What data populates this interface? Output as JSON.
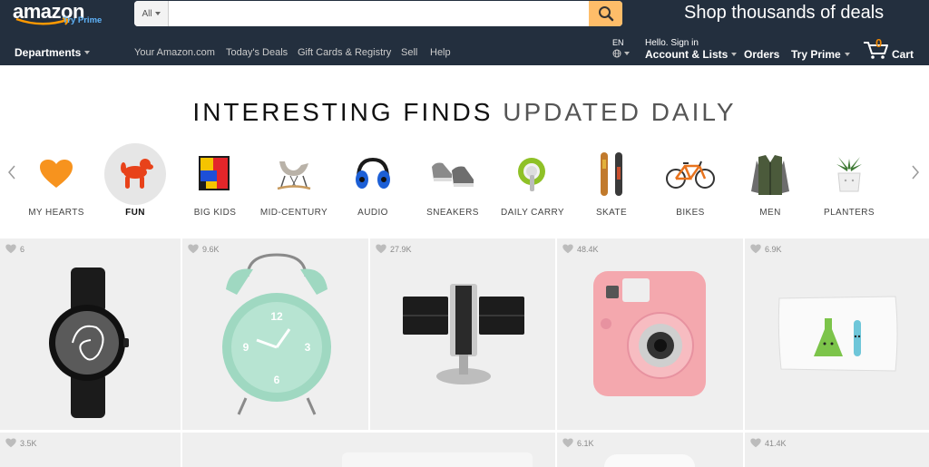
{
  "header": {
    "logo_text": "amazon",
    "logo_prime": "Try Prime",
    "search": {
      "category": "All",
      "placeholder": "",
      "value": ""
    },
    "promo": "Shop thousands of deals",
    "departments": "Departments",
    "nav_links": [
      "Your Amazon.com",
      "Today's Deals",
      "Gift Cards & Registry",
      "Sell",
      "Help"
    ],
    "language": "EN",
    "account_hello": "Hello. Sign in",
    "account_main": "Account & Lists",
    "orders": "Orders",
    "try_prime": "Try Prime",
    "cart_count": "0",
    "cart_label": "Cart"
  },
  "hero": {
    "bold": "INTERESTING FINDS",
    "light": "UPDATED DAILY"
  },
  "categories": [
    {
      "label": "MY HEARTS",
      "icon": "heart-icon",
      "active": false
    },
    {
      "label": "FUN",
      "icon": "balloon-dog-icon",
      "active": true
    },
    {
      "label": "BIG KIDS",
      "icon": "puzzle-blocks-icon",
      "active": false
    },
    {
      "label": "MID-CENTURY",
      "icon": "eames-chair-icon",
      "active": false
    },
    {
      "label": "AUDIO",
      "icon": "headphones-icon",
      "active": false
    },
    {
      "label": "SNEAKERS",
      "icon": "sneakers-icon",
      "active": false
    },
    {
      "label": "DAILY CARRY",
      "icon": "key-ring-icon",
      "active": false
    },
    {
      "label": "SKATE",
      "icon": "skateboard-icon",
      "active": false
    },
    {
      "label": "BIKES",
      "icon": "bicycle-icon",
      "active": false
    },
    {
      "label": "MEN",
      "icon": "vest-icon",
      "active": false
    },
    {
      "label": "PLANTERS",
      "icon": "planter-icon",
      "active": false
    }
  ],
  "products": [
    {
      "hearts": "6",
      "item": "watch"
    },
    {
      "hearts": "9.6K",
      "item": "alarm-clock"
    },
    {
      "hearts": "27.9K",
      "item": "flip-clock"
    },
    {
      "hearts": "48.4K",
      "item": "instant-camera"
    },
    {
      "hearts": "6.9K",
      "item": "pillowcase"
    },
    {
      "hearts": "3.5K",
      "item": "product"
    },
    {
      "hearts": "",
      "item": "product"
    },
    {
      "hearts": "",
      "item": "product"
    },
    {
      "hearts": "6.1K",
      "item": "product"
    },
    {
      "hearts": "41.4K",
      "item": "product"
    }
  ],
  "colors": {
    "nav_bg": "#232f3e",
    "search_button": "#febd69",
    "cart_count": "#f08804",
    "heart_orange": "#f7931e",
    "card_bg": "#efefef"
  }
}
